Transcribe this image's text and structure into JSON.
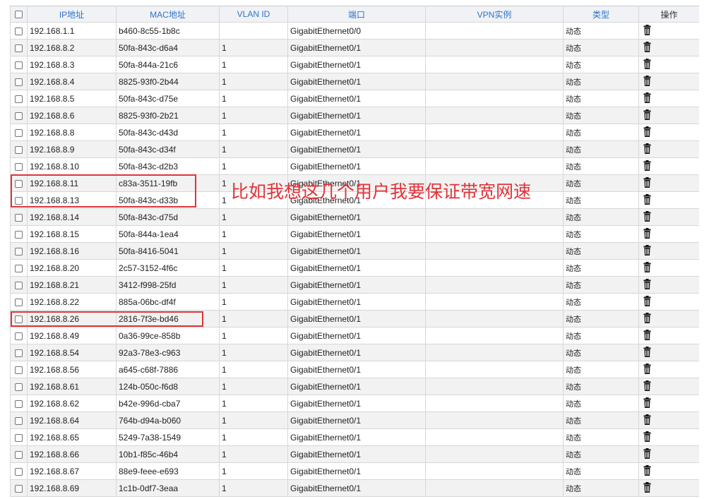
{
  "table": {
    "columns": {
      "ip": "IP地址",
      "mac": "MAC地址",
      "vlan": "VLAN ID",
      "port": "端口",
      "vpn": "VPN实例",
      "type": "类型",
      "op": "操作"
    },
    "rows": [
      {
        "ip": "192.168.1.1",
        "mac": "b460-8c55-1b8c",
        "vlan": "",
        "port": "GigabitEthernet0/0",
        "vpn": "",
        "type": "动态"
      },
      {
        "ip": "192.168.8.2",
        "mac": "50fa-843c-d6a4",
        "vlan": "1",
        "port": "GigabitEthernet0/1",
        "vpn": "",
        "type": "动态"
      },
      {
        "ip": "192.168.8.3",
        "mac": "50fa-844a-21c6",
        "vlan": "1",
        "port": "GigabitEthernet0/1",
        "vpn": "",
        "type": "动态"
      },
      {
        "ip": "192.168.8.4",
        "mac": "8825-93f0-2b44",
        "vlan": "1",
        "port": "GigabitEthernet0/1",
        "vpn": "",
        "type": "动态"
      },
      {
        "ip": "192.168.8.5",
        "mac": "50fa-843c-d75e",
        "vlan": "1",
        "port": "GigabitEthernet0/1",
        "vpn": "",
        "type": "动态"
      },
      {
        "ip": "192.168.8.6",
        "mac": "8825-93f0-2b21",
        "vlan": "1",
        "port": "GigabitEthernet0/1",
        "vpn": "",
        "type": "动态"
      },
      {
        "ip": "192.168.8.8",
        "mac": "50fa-843c-d43d",
        "vlan": "1",
        "port": "GigabitEthernet0/1",
        "vpn": "",
        "type": "动态"
      },
      {
        "ip": "192.168.8.9",
        "mac": "50fa-843c-d34f",
        "vlan": "1",
        "port": "GigabitEthernet0/1",
        "vpn": "",
        "type": "动态"
      },
      {
        "ip": "192.168.8.10",
        "mac": "50fa-843c-d2b3",
        "vlan": "1",
        "port": "GigabitEthernet0/1",
        "vpn": "",
        "type": "动态"
      },
      {
        "ip": "192.168.8.11",
        "mac": "c83a-3511-19fb",
        "vlan": "1",
        "port": "GigabitEthernet0/1",
        "vpn": "",
        "type": "动态"
      },
      {
        "ip": "192.168.8.13",
        "mac": "50fa-843c-d33b",
        "vlan": "1",
        "port": "GigabitEthernet0/1",
        "vpn": "",
        "type": "动态"
      },
      {
        "ip": "192.168.8.14",
        "mac": "50fa-843c-d75d",
        "vlan": "1",
        "port": "GigabitEthernet0/1",
        "vpn": "",
        "type": "动态"
      },
      {
        "ip": "192.168.8.15",
        "mac": "50fa-844a-1ea4",
        "vlan": "1",
        "port": "GigabitEthernet0/1",
        "vpn": "",
        "type": "动态"
      },
      {
        "ip": "192.168.8.16",
        "mac": "50fa-8416-5041",
        "vlan": "1",
        "port": "GigabitEthernet0/1",
        "vpn": "",
        "type": "动态"
      },
      {
        "ip": "192.168.8.20",
        "mac": "2c57-3152-4f6c",
        "vlan": "1",
        "port": "GigabitEthernet0/1",
        "vpn": "",
        "type": "动态"
      },
      {
        "ip": "192.168.8.21",
        "mac": "3412-f998-25fd",
        "vlan": "1",
        "port": "GigabitEthernet0/1",
        "vpn": "",
        "type": "动态"
      },
      {
        "ip": "192.168.8.22",
        "mac": "885a-06bc-df4f",
        "vlan": "1",
        "port": "GigabitEthernet0/1",
        "vpn": "",
        "type": "动态"
      },
      {
        "ip": "192.168.8.26",
        "mac": "2816-7f3e-bd46",
        "vlan": "1",
        "port": "GigabitEthernet0/1",
        "vpn": "",
        "type": "动态"
      },
      {
        "ip": "192.168.8.49",
        "mac": "0a36-99ce-858b",
        "vlan": "1",
        "port": "GigabitEthernet0/1",
        "vpn": "",
        "type": "动态"
      },
      {
        "ip": "192.168.8.54",
        "mac": "92a3-78e3-c963",
        "vlan": "1",
        "port": "GigabitEthernet0/1",
        "vpn": "",
        "type": "动态"
      },
      {
        "ip": "192.168.8.56",
        "mac": "a645-c68f-7886",
        "vlan": "1",
        "port": "GigabitEthernet0/1",
        "vpn": "",
        "type": "动态"
      },
      {
        "ip": "192.168.8.61",
        "mac": "124b-050c-f6d8",
        "vlan": "1",
        "port": "GigabitEthernet0/1",
        "vpn": "",
        "type": "动态"
      },
      {
        "ip": "192.168.8.62",
        "mac": "b42e-996d-cba7",
        "vlan": "1",
        "port": "GigabitEthernet0/1",
        "vpn": "",
        "type": "动态"
      },
      {
        "ip": "192.168.8.64",
        "mac": "764b-d94a-b060",
        "vlan": "1",
        "port": "GigabitEthernet0/1",
        "vpn": "",
        "type": "动态"
      },
      {
        "ip": "192.168.8.65",
        "mac": "5249-7a38-1549",
        "vlan": "1",
        "port": "GigabitEthernet0/1",
        "vpn": "",
        "type": "动态"
      },
      {
        "ip": "192.168.8.66",
        "mac": "10b1-f85c-46b4",
        "vlan": "1",
        "port": "GigabitEthernet0/1",
        "vpn": "",
        "type": "动态"
      },
      {
        "ip": "192.168.8.67",
        "mac": "88e9-feee-e693",
        "vlan": "1",
        "port": "GigabitEthernet0/1",
        "vpn": "",
        "type": "动态"
      },
      {
        "ip": "192.168.8.69",
        "mac": "1c1b-0df7-3eaa",
        "vlan": "1",
        "port": "GigabitEthernet0/1",
        "vpn": "",
        "type": "动态"
      }
    ]
  },
  "annotation": {
    "text": "比如我想这几个用户我要保证带宽网速",
    "color": "#e0343a"
  },
  "icons": {
    "row_action": "trash-icon"
  },
  "colors": {
    "header_text": "#2f73c9",
    "stripe": "#f2f2f2",
    "border": "#d7d7d7"
  }
}
